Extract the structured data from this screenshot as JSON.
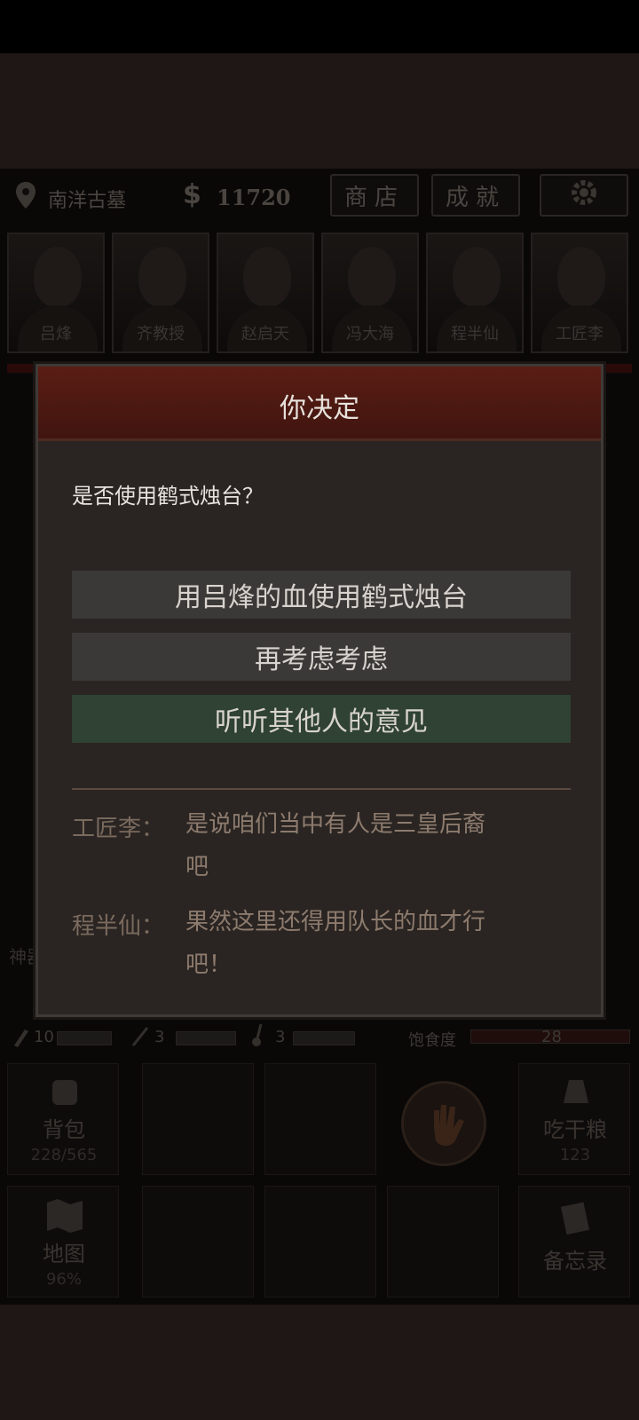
{
  "header": {
    "location": "南洋古墓",
    "money": "11720",
    "money_symbol": "$",
    "shop_button": "商店",
    "achievement_button": "成就"
  },
  "party": [
    {
      "name": "吕烽"
    },
    {
      "name": "齐教授"
    },
    {
      "name": "赵启天"
    },
    {
      "name": "冯大海"
    },
    {
      "name": "程半仙"
    },
    {
      "name": "工匠李"
    }
  ],
  "stats": {
    "shovel_count": "10",
    "pick_count": "3",
    "spade_count": "3",
    "hunger_label": "饱食度",
    "hunger_value": "28"
  },
  "side_tab": "神器",
  "grid": {
    "backpack_label": "背包",
    "backpack_count": "228/565",
    "eat_label": "吃干粮",
    "eat_count": "123",
    "map_label": "地图",
    "map_percent": "96%",
    "memo_label": "备忘录"
  },
  "dialog": {
    "title": "你决定",
    "question": "是否使用鹤式烛台？",
    "choices": [
      {
        "label": "用吕烽的血使用鹤式烛台",
        "style": "grey"
      },
      {
        "label": "再考虑考虑",
        "style": "grey"
      },
      {
        "label": "听听其他人的意见",
        "style": "green"
      }
    ],
    "comments": [
      {
        "speaker": "工匠李：",
        "line1": "是说咱们当中有人是三皇后裔",
        "line2": "吧"
      },
      {
        "speaker": "程半仙：",
        "line1": "果然这里还得用队长的血才行",
        "line2": "吧！"
      }
    ]
  },
  "colors": {
    "dialog_header": "#5a1d14",
    "choice_grey": "#3b3937",
    "choice_green": "#2f4233",
    "background": "#090807"
  }
}
